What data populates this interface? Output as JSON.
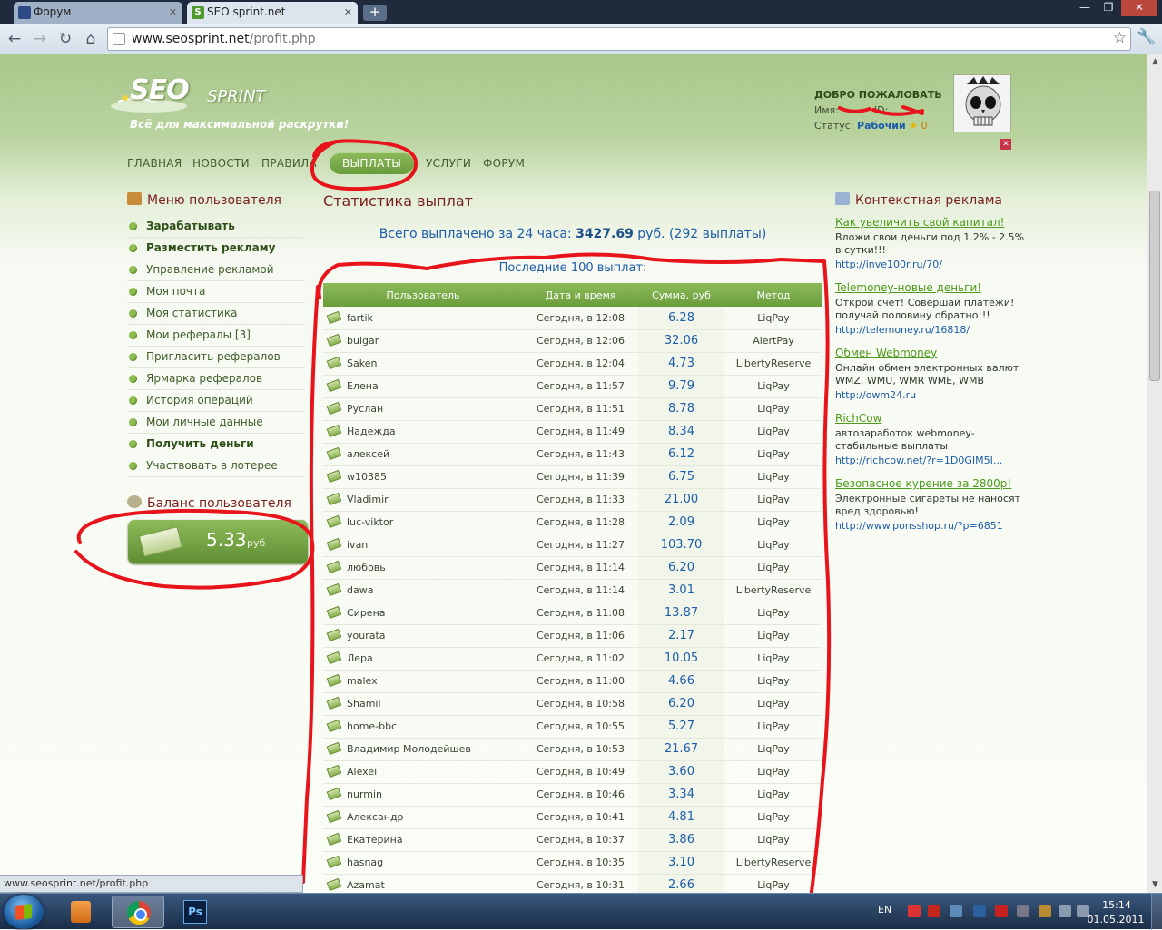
{
  "browser": {
    "tabs": [
      {
        "label": "Форум"
      },
      {
        "label": "SEO sprint.net"
      }
    ],
    "new_tab": "+",
    "url_host": "www.seosprint.net",
    "url_path": "/profit.php",
    "status_url": "www.seosprint.net/profit.php",
    "win_minimize": "—",
    "win_maximize": "❐",
    "win_close": "✕"
  },
  "site": {
    "logo_seo": "SEO",
    "logo_sprint": "SPRINT",
    "tagline": "Всё для максимальной раскрутки!",
    "nav": [
      {
        "label": "ГЛАВНАЯ"
      },
      {
        "label": "НОВОСТИ"
      },
      {
        "label": "ПРАВИЛА"
      },
      {
        "label": "ВЫПЛАТЫ"
      },
      {
        "label": "УСЛУГИ"
      },
      {
        "label": "ФОРУМ"
      }
    ]
  },
  "welcome": {
    "title": "ДОБРО ПОЖАЛОВАТЬ",
    "name_label": "Имя:",
    "id_label": "ID:",
    "status_label": "Статус:",
    "status_value": "Рабочий",
    "star": "★",
    "rating": "0",
    "remove": "✕"
  },
  "usermenu": {
    "title": "Меню пользователя",
    "items": [
      {
        "label": "Зарабатывать",
        "bold": true
      },
      {
        "label": "Разместить рекламу",
        "bold": true
      },
      {
        "label": "Управление рекламой",
        "bold": false
      },
      {
        "label": "Моя почта",
        "bold": false
      },
      {
        "label": "Моя статистика",
        "bold": false
      },
      {
        "label": "Мои рефералы [3]",
        "bold": false
      },
      {
        "label": "Пригласить рефералов",
        "bold": false
      },
      {
        "label": "Ярмарка рефералов",
        "bold": false
      },
      {
        "label": "История операций",
        "bold": false
      },
      {
        "label": "Мои личные данные",
        "bold": false
      },
      {
        "label": "Получить деньги",
        "bold": true
      },
      {
        "label": "Участвовать в лотерее",
        "bold": false
      }
    ]
  },
  "balance": {
    "title": "Баланс пользователя",
    "value": "5.33",
    "unit": "руб"
  },
  "stats": {
    "title": "Статистика выплат",
    "total_prefix": "Всего выплачено за 24 часа: ",
    "total_amount": "3427.69",
    "total_suffix": " руб. (292 выплаты)",
    "last100": "Последние 100 выплат:",
    "columns": [
      "Пользователь",
      "Дата и время",
      "Сумма, руб",
      "Метод"
    ],
    "rows": [
      {
        "user": "fartik",
        "date": "Сегодня, в 12:08",
        "sum": "6.28",
        "method": "LiqPay"
      },
      {
        "user": "bulgar",
        "date": "Сегодня, в 12:06",
        "sum": "32.06",
        "method": "AlertPay"
      },
      {
        "user": "Saken",
        "date": "Сегодня, в 12:04",
        "sum": "4.73",
        "method": "LibertyReserve"
      },
      {
        "user": "Елена",
        "date": "Сегодня, в 11:57",
        "sum": "9.79",
        "method": "LiqPay"
      },
      {
        "user": "Руслан",
        "date": "Сегодня, в 11:51",
        "sum": "8.78",
        "method": "LiqPay"
      },
      {
        "user": "Надежда",
        "date": "Сегодня, в 11:49",
        "sum": "8.34",
        "method": "LiqPay"
      },
      {
        "user": "алексей",
        "date": "Сегодня, в 11:43",
        "sum": "6.12",
        "method": "LiqPay"
      },
      {
        "user": "w10385",
        "date": "Сегодня, в 11:39",
        "sum": "6.75",
        "method": "LiqPay"
      },
      {
        "user": "Vladimir",
        "date": "Сегодня, в 11:33",
        "sum": "21.00",
        "method": "LiqPay"
      },
      {
        "user": "luc-viktor",
        "date": "Сегодня, в 11:28",
        "sum": "2.09",
        "method": "LiqPay"
      },
      {
        "user": "ivan",
        "date": "Сегодня, в 11:27",
        "sum": "103.70",
        "method": "LiqPay"
      },
      {
        "user": "любовь",
        "date": "Сегодня, в 11:14",
        "sum": "6.20",
        "method": "LiqPay"
      },
      {
        "user": "dawa",
        "date": "Сегодня, в 11:14",
        "sum": "3.01",
        "method": "LibertyReserve"
      },
      {
        "user": "Сирена",
        "date": "Сегодня, в 11:08",
        "sum": "13.87",
        "method": "LiqPay"
      },
      {
        "user": "yourata",
        "date": "Сегодня, в 11:06",
        "sum": "2.17",
        "method": "LiqPay"
      },
      {
        "user": "Лера",
        "date": "Сегодня, в 11:02",
        "sum": "10.05",
        "method": "LiqPay"
      },
      {
        "user": "malex",
        "date": "Сегодня, в 11:00",
        "sum": "4.66",
        "method": "LiqPay"
      },
      {
        "user": "Shamil",
        "date": "Сегодня, в 10:58",
        "sum": "6.20",
        "method": "LiqPay"
      },
      {
        "user": "home-bbc",
        "date": "Сегодня, в 10:55",
        "sum": "5.27",
        "method": "LiqPay"
      },
      {
        "user": "Владимир Молодейшев",
        "date": "Сегодня, в 10:53",
        "sum": "21.67",
        "method": "LiqPay"
      },
      {
        "user": "Alexei",
        "date": "Сегодня, в 10:49",
        "sum": "3.60",
        "method": "LiqPay"
      },
      {
        "user": "nurmin",
        "date": "Сегодня, в 10:46",
        "sum": "3.34",
        "method": "LiqPay"
      },
      {
        "user": "Александр",
        "date": "Сегодня, в 10:41",
        "sum": "4.81",
        "method": "LiqPay"
      },
      {
        "user": "Екатерина",
        "date": "Сегодня, в 10:37",
        "sum": "3.86",
        "method": "LiqPay"
      },
      {
        "user": "hasnag",
        "date": "Сегодня, в 10:35",
        "sum": "3.10",
        "method": "LibertyReserve"
      },
      {
        "user": "Azamat",
        "date": "Сегодня, в 10:31",
        "sum": "2.66",
        "method": "LiqPay"
      }
    ]
  },
  "ads": {
    "title": "Контекстная реклама",
    "items": [
      {
        "title": "Как увеличить свой капитал!",
        "desc": "Вложи свои деньги под 1.2% - 2.5% в сутки!!!",
        "url": "http://inve100r.ru/70/"
      },
      {
        "title": "Telemoney-новые деньги!",
        "desc": "Открой счет! Совершай платежи! получай половину обратно!!!",
        "url": "http://telemoney.ru/16818/"
      },
      {
        "title": "Обмен Webmoney",
        "desc": "Онлайн обмен электронных валют WMZ, WMU, WMR WME, WMB",
        "url": "http://owm24.ru"
      },
      {
        "title": "RichCow",
        "desc": "автозаработок webmoney-стабильные выплаты",
        "url": "http://richcow.net/?r=1D0GIM5I..."
      },
      {
        "title": "Безопасное курение за 2800р!",
        "desc": "Электронные сигареты не наносят вред здоровью!",
        "url": "http://www.ponsshop.ru/?p=6851"
      }
    ]
  },
  "taskbar": {
    "lang": "EN",
    "time": "15:14",
    "date": "01.05.2011",
    "ps_label": "Ps"
  }
}
